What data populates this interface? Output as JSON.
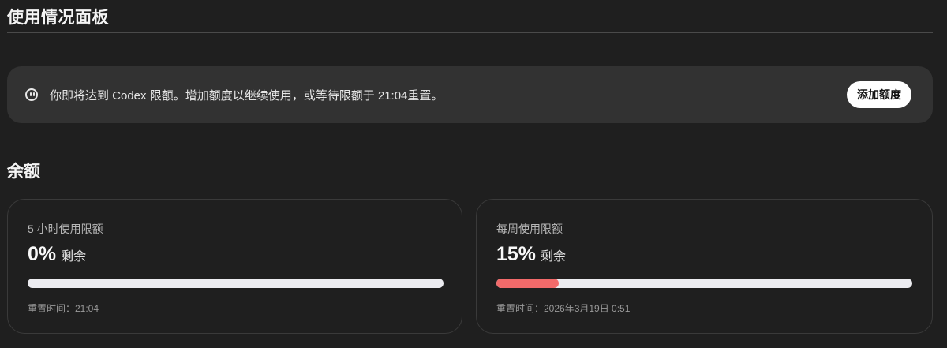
{
  "page": {
    "title": "使用情况面板"
  },
  "notice": {
    "icon": "pause-circle-icon",
    "text": "你即将达到 Codex 限额。增加额度以继续使用，或等待限额于 21:04重置。",
    "button_label": "添加额度"
  },
  "balance": {
    "section_title": "余额",
    "cards": [
      {
        "label": "5 小时使用限额",
        "percent_text": "0%",
        "remaining_label": "剩余",
        "remaining_fraction": 0,
        "reset_text": "重置时间：21:04"
      },
      {
        "label": "每周使用限额",
        "percent_text": "15%",
        "remaining_label": "剩余",
        "remaining_fraction": 0.15,
        "reset_text": "重置时间：2026年3月19日 0:51"
      }
    ]
  },
  "colors": {
    "background": "#1f1f1f",
    "banner": "#323232",
    "progress_track": "#ececf0",
    "progress_fill": "#f26a6a",
    "button_bg": "#ffffff"
  }
}
